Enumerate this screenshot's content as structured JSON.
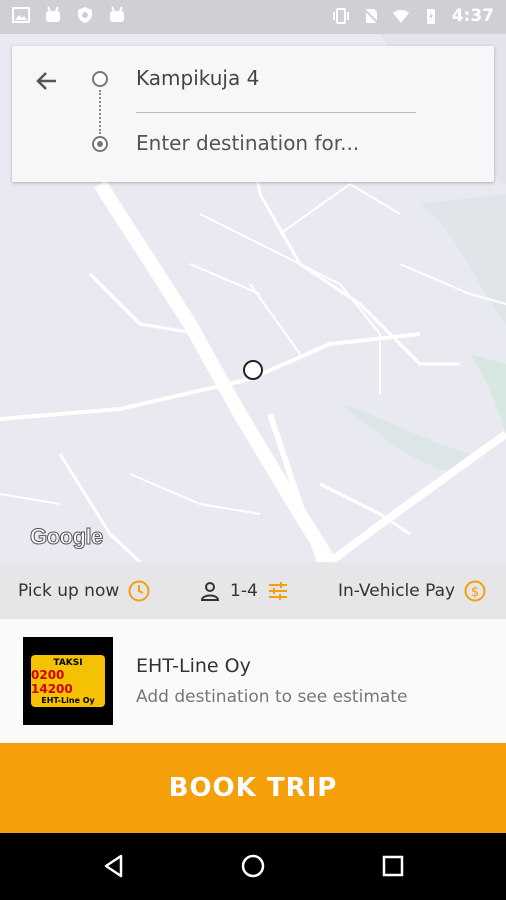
{
  "status_bar": {
    "time": "4:37"
  },
  "search": {
    "pickup_address": "Kampikuja 4",
    "destination_placeholder": "Enter destination for..."
  },
  "map": {
    "attribution": "Google"
  },
  "options": {
    "pickup_time": "Pick up now",
    "passengers": "1-4",
    "payment": "In-Vehicle Pay"
  },
  "provider": {
    "name": "EHT-Line Oy",
    "estimate_text": "Add destination to see estimate",
    "logo": {
      "line1": "TAKSI",
      "line2": "0200 14200",
      "line3": "EHT-Line Oy"
    }
  },
  "book_button": {
    "label": "BOOK TRIP"
  },
  "colors": {
    "accent": "#f5a00a",
    "icon_orange": "#f5a00a"
  }
}
